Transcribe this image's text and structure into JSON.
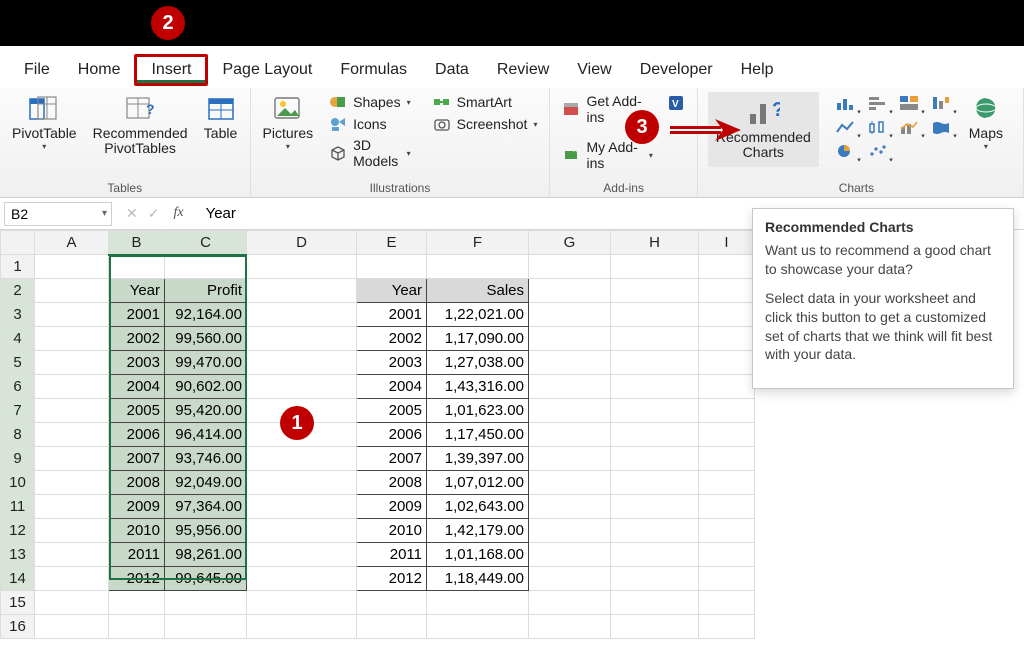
{
  "tabs": {
    "file": "File",
    "home": "Home",
    "insert": "Insert",
    "page_layout": "Page Layout",
    "formulas": "Formulas",
    "data": "Data",
    "review": "Review",
    "view": "View",
    "developer": "Developer",
    "help": "Help"
  },
  "ribbon": {
    "tables": {
      "group": "Tables",
      "pivot": "PivotTable",
      "rec_pivot": "Recommended\nPivotTables",
      "table": "Table"
    },
    "illustrations": {
      "group": "Illustrations",
      "pictures": "Pictures",
      "shapes": "Shapes",
      "icons": "Icons",
      "models": "3D Models"
    },
    "addins": {
      "group": "Add-ins",
      "smartart": "SmartArt",
      "screenshot": "Screenshot",
      "get": "Get Add-ins",
      "my": "My Add-ins"
    },
    "charts": {
      "group": "Charts",
      "recommended": "Recommended\nCharts",
      "maps": "Maps"
    }
  },
  "namebox": "B2",
  "formula": "Year",
  "col_headers": [
    "A",
    "B",
    "C",
    "D",
    "E",
    "F",
    "G",
    "H",
    "I"
  ],
  "row_headers": [
    1,
    2,
    3,
    4,
    5,
    6,
    7,
    8,
    9,
    10,
    11,
    12,
    13,
    14,
    15,
    16
  ],
  "table1": {
    "head": [
      "Year",
      "Profit"
    ],
    "rows": [
      [
        "2001",
        "92,164.00"
      ],
      [
        "2002",
        "99,560.00"
      ],
      [
        "2003",
        "99,470.00"
      ],
      [
        "2004",
        "90,602.00"
      ],
      [
        "2005",
        "95,420.00"
      ],
      [
        "2006",
        "96,414.00"
      ],
      [
        "2007",
        "93,746.00"
      ],
      [
        "2008",
        "92,049.00"
      ],
      [
        "2009",
        "97,364.00"
      ],
      [
        "2010",
        "95,956.00"
      ],
      [
        "2011",
        "98,261.00"
      ],
      [
        "2012",
        "99,645.00"
      ]
    ]
  },
  "table2": {
    "head": [
      "Year",
      "Sales"
    ],
    "rows": [
      [
        "2001",
        "1,22,021.00"
      ],
      [
        "2002",
        "1,17,090.00"
      ],
      [
        "2003",
        "1,27,038.00"
      ],
      [
        "2004",
        "1,43,316.00"
      ],
      [
        "2005",
        "1,01,623.00"
      ],
      [
        "2006",
        "1,17,450.00"
      ],
      [
        "2007",
        "1,39,397.00"
      ],
      [
        "2008",
        "1,07,012.00"
      ],
      [
        "2009",
        "1,02,643.00"
      ],
      [
        "2010",
        "1,42,179.00"
      ],
      [
        "2011",
        "1,01,168.00"
      ],
      [
        "2012",
        "1,18,449.00"
      ]
    ]
  },
  "tooltip": {
    "title": "Recommended Charts",
    "p1": "Want us to recommend a good chart to showcase your data?",
    "p2": "Select data in your worksheet and click this button to get a customized set of charts that we think will fit best with your data."
  },
  "badges": {
    "one": "1",
    "two": "2",
    "three": "3"
  },
  "chart_data": [
    {
      "type": "table",
      "title": "Profit by Year",
      "columns": [
        "Year",
        "Profit"
      ],
      "rows": [
        [
          2001,
          92164.0
        ],
        [
          2002,
          99560.0
        ],
        [
          2003,
          99470.0
        ],
        [
          2004,
          90602.0
        ],
        [
          2005,
          95420.0
        ],
        [
          2006,
          96414.0
        ],
        [
          2007,
          93746.0
        ],
        [
          2008,
          92049.0
        ],
        [
          2009,
          97364.0
        ],
        [
          2010,
          95956.0
        ],
        [
          2011,
          98261.0
        ],
        [
          2012,
          99645.0
        ]
      ]
    },
    {
      "type": "table",
      "title": "Sales by Year",
      "columns": [
        "Year",
        "Sales"
      ],
      "rows": [
        [
          2001,
          122021.0
        ],
        [
          2002,
          117090.0
        ],
        [
          2003,
          127038.0
        ],
        [
          2004,
          143316.0
        ],
        [
          2005,
          101623.0
        ],
        [
          2006,
          117450.0
        ],
        [
          2007,
          139397.0
        ],
        [
          2008,
          107012.0
        ],
        [
          2009,
          102643.0
        ],
        [
          2010,
          142179.0
        ],
        [
          2011,
          101168.0
        ],
        [
          2012,
          118449.0
        ]
      ]
    }
  ]
}
